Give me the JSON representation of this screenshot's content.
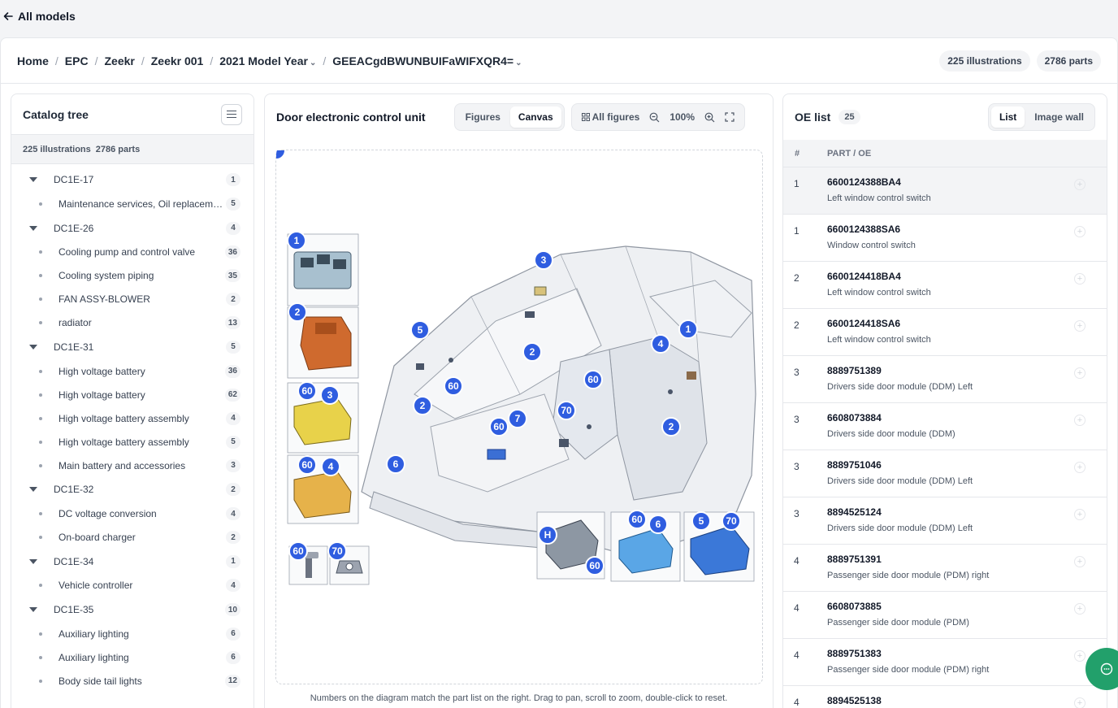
{
  "nav": {
    "back_label": "All models"
  },
  "breadcrumb": {
    "items": [
      "Home",
      "EPC",
      "Zeekr",
      "Zeekr 001",
      "2021 Model Year",
      "GEEACgdBWUNBUIFaWIFXQR4="
    ],
    "separator": "/"
  },
  "stats": {
    "illustrations": "225 illustrations",
    "parts": "2786 parts"
  },
  "catalog": {
    "title": "Catalog tree",
    "summary_illustrations": "225 illustrations",
    "summary_parts": "2786 parts",
    "rows": [
      {
        "type": "group",
        "label": "DC1E-17",
        "count": "1"
      },
      {
        "type": "leaf",
        "label": "Maintenance services, Oil replacement",
        "count": "5"
      },
      {
        "type": "group",
        "label": "DC1E-26",
        "count": "4"
      },
      {
        "type": "leaf",
        "label": "Cooling pump and control valve",
        "count": "36"
      },
      {
        "type": "leaf",
        "label": "Cooling system piping",
        "count": "35"
      },
      {
        "type": "leaf",
        "label": "FAN ASSY-BLOWER",
        "count": "2"
      },
      {
        "type": "leaf",
        "label": "radiator",
        "count": "13"
      },
      {
        "type": "group",
        "label": "DC1E-31",
        "count": "5"
      },
      {
        "type": "leaf",
        "label": "High voltage battery",
        "count": "36"
      },
      {
        "type": "leaf",
        "label": "High voltage battery",
        "count": "62"
      },
      {
        "type": "leaf",
        "label": "High voltage battery assembly",
        "count": "4"
      },
      {
        "type": "leaf",
        "label": "High voltage battery assembly",
        "count": "5"
      },
      {
        "type": "leaf",
        "label": "Main battery and accessories",
        "count": "3"
      },
      {
        "type": "group",
        "label": "DC1E-32",
        "count": "2"
      },
      {
        "type": "leaf",
        "label": "DC voltage conversion",
        "count": "4"
      },
      {
        "type": "leaf",
        "label": "On-board charger",
        "count": "2"
      },
      {
        "type": "group",
        "label": "DC1E-34",
        "count": "1"
      },
      {
        "type": "leaf",
        "label": "Vehicle controller",
        "count": "4"
      },
      {
        "type": "group",
        "label": "DC1E-35",
        "count": "10"
      },
      {
        "type": "leaf",
        "label": "Auxiliary lighting",
        "count": "6"
      },
      {
        "type": "leaf",
        "label": "Auxiliary lighting",
        "count": "6"
      },
      {
        "type": "leaf",
        "label": "Body side tail lights",
        "count": "12"
      }
    ]
  },
  "viewer": {
    "title": "Door electronic control unit",
    "view_tabs": [
      "Figures",
      "Canvas"
    ],
    "active_tab": "Canvas",
    "all_figures_label": "All figures",
    "zoom": "100%",
    "hint": "Numbers on the diagram match the part list on the right. Drag to pan, scroll to zoom, double-click to reset.",
    "callouts": [
      "1",
      "2",
      "60",
      "3",
      "60",
      "4",
      "60",
      "70",
      "3",
      "5",
      "60",
      "2",
      "1",
      "4",
      "60",
      "2",
      "2",
      "60",
      "7",
      "70",
      "6",
      "H",
      "60",
      "6",
      "60",
      "5",
      "70",
      "7"
    ]
  },
  "oe_list": {
    "title": "OE list",
    "count": "25",
    "view_tabs": [
      "List",
      "Image wall"
    ],
    "active_tab": "List",
    "columns": [
      "#",
      "PART / OE"
    ],
    "rows": [
      {
        "num": "1",
        "part": "6600124388BA4",
        "desc": "Left window control switch"
      },
      {
        "num": "1",
        "part": "6600124388SA6",
        "desc": "Window control switch"
      },
      {
        "num": "2",
        "part": "6600124418BA4",
        "desc": "Left window control switch"
      },
      {
        "num": "2",
        "part": "6600124418SA6",
        "desc": "Left window control switch"
      },
      {
        "num": "3",
        "part": "8889751389",
        "desc": "Drivers side door module (DDM) Left"
      },
      {
        "num": "3",
        "part": "6608073884",
        "desc": "Drivers side door module (DDM)"
      },
      {
        "num": "3",
        "part": "8889751046",
        "desc": "Drivers side door module (DDM) Left"
      },
      {
        "num": "3",
        "part": "8894525124",
        "desc": "Drivers side door module (DDM) Left"
      },
      {
        "num": "4",
        "part": "8889751391",
        "desc": "Passenger side door module (PDM) right"
      },
      {
        "num": "4",
        "part": "6608073885",
        "desc": "Passenger side door module (PDM)"
      },
      {
        "num": "4",
        "part": "8889751383",
        "desc": "Passenger side door module (PDM) right"
      },
      {
        "num": "4",
        "part": "8894525138",
        "desc": ""
      }
    ]
  },
  "colors": {
    "accent": "#2f5de0",
    "fab": "#22a06b"
  }
}
